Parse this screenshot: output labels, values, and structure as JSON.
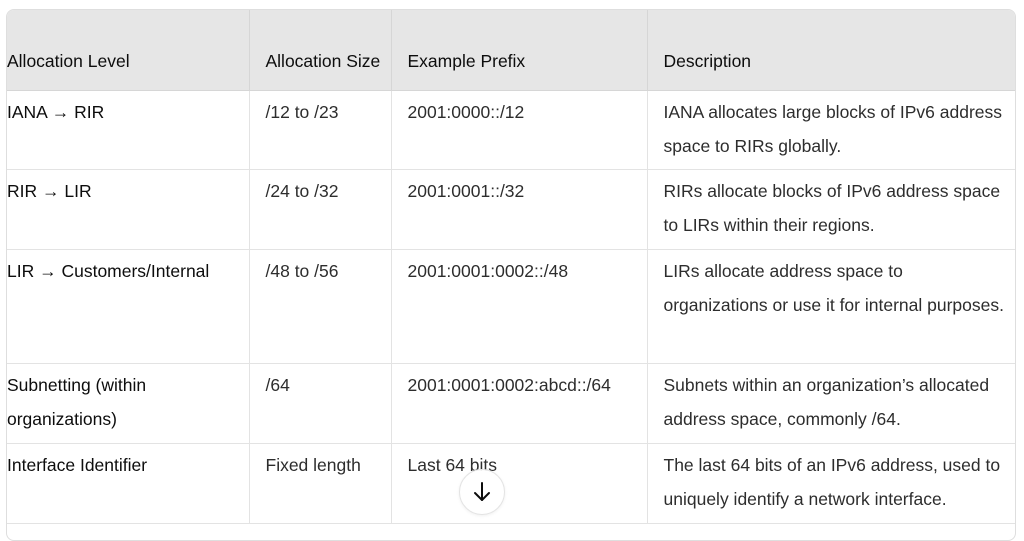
{
  "table": {
    "headers": [
      "Allocation Level",
      "Allocation Size",
      "Example Prefix",
      "Description"
    ],
    "rows": [
      {
        "level": "IANA → RIR",
        "size": "/12 to /23",
        "prefix": "2001:0000::/12",
        "description": "IANA allocates large blocks of IPv6 address space to RIRs globally."
      },
      {
        "level": "RIR → LIR",
        "size": "/24 to /32",
        "prefix": "2001:0001::/32",
        "description": "RIRs allocate blocks of IPv6 address space to LIRs within their regions."
      },
      {
        "level": "LIR → Customers/Internal",
        "size": "/48 to /56",
        "prefix": "2001:0001:0002::/48",
        "description": "LIRs allocate address space to organizations or use it for internal purposes."
      },
      {
        "level": "Subnetting (within organizations)",
        "size": "/64",
        "prefix": "2001:0001:0002:abcd::/64",
        "description": "Subnets within an organization’s allocated address space, commonly /64."
      },
      {
        "level": "Interface Identifier",
        "size": "Fixed length",
        "prefix": "Last 64 bits",
        "description": "The last 64 bits of an IPv6 address, used to uniquely identify a network interface."
      }
    ]
  },
  "scroll_button": {
    "icon": "arrow-down-icon"
  }
}
